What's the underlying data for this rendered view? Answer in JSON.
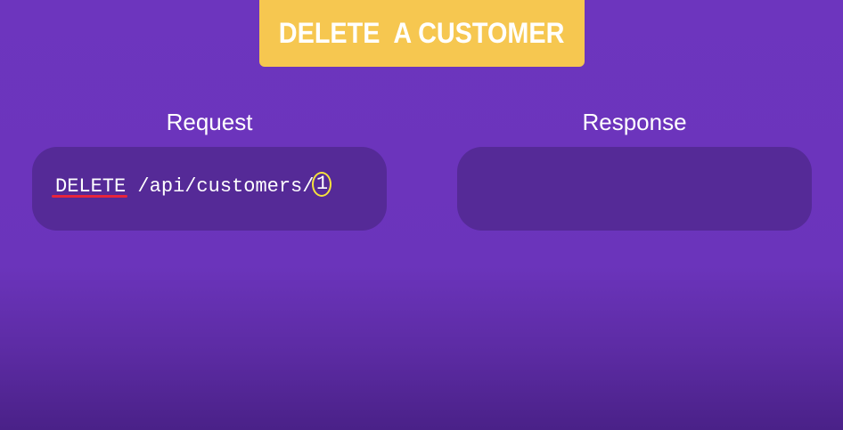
{
  "title": "DELETE  A CUSTOMER",
  "request": {
    "heading": "Request",
    "method": "DELETE",
    "path": "/api/customers/",
    "id": "1"
  },
  "response": {
    "heading": "Response"
  },
  "colors": {
    "background": "#6b34bb",
    "banner": "#f6c750",
    "panel": "#552a97",
    "underline": "#e8243c",
    "highlight_circle": "#f6e23c"
  }
}
